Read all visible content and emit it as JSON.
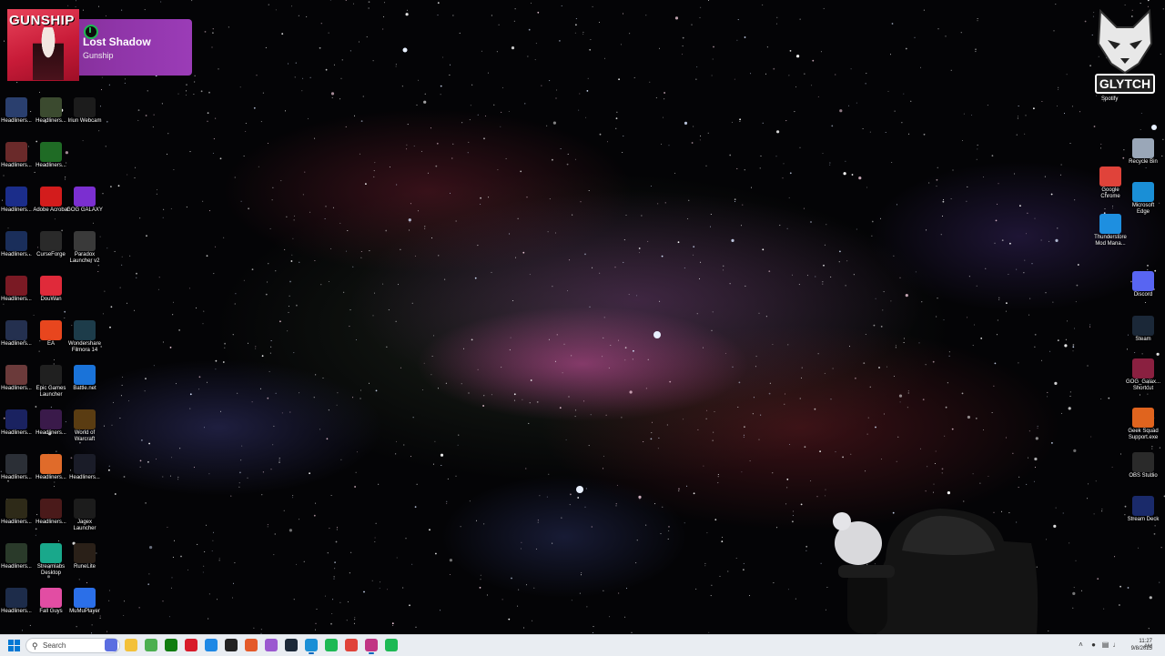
{
  "now_playing": {
    "album_art_text": "GUNSHIP",
    "title": "Lost Shadow",
    "artist": "Gunship"
  },
  "desktop_left": [
    {
      "label": "Headliners...",
      "color": "#2a3f6e",
      "icon": "game-thumb-icon"
    },
    {
      "label": "Headliners...",
      "color": "#3b4a2f",
      "icon": "game-thumb-icon"
    },
    {
      "label": "Iriun Webcam",
      "color": "#1c1c1c",
      "icon": "webcam-icon"
    },
    {
      "label": "Headliners...",
      "color": "#6a2a2a",
      "icon": "game-thumb-icon"
    },
    {
      "label": "Headliners...",
      "color": "#1f6b25",
      "icon": "game-thumb-icon"
    },
    {
      "label": "Headliners...",
      "color": "#1b2d8a",
      "icon": "game-thumb-icon"
    },
    {
      "label": "Adobe Acrobat",
      "color": "#d31c1c",
      "icon": "acrobat-icon"
    },
    {
      "label": "GOG GALAXY",
      "color": "#7b2fd0",
      "icon": "gog-galaxy-icon"
    },
    {
      "label": "Headliners...",
      "color": "#1a2e5a",
      "icon": "game-thumb-icon"
    },
    {
      "label": "CurseForge",
      "color": "#2a2a2a",
      "icon": "curseforge-icon"
    },
    {
      "label": "Paradox Launcher v2",
      "color": "#3a3a3a",
      "icon": "paradox-icon"
    },
    {
      "label": "Headliners...",
      "color": "#7a1a24",
      "icon": "game-thumb-icon"
    },
    {
      "label": "DouWan",
      "color": "#e02a3a",
      "icon": "douwan-icon"
    },
    {
      "label": "Headliners...",
      "color": "#24304f",
      "icon": "game-thumb-icon"
    },
    {
      "label": "EA",
      "color": "#e8461e",
      "icon": "ea-icon"
    },
    {
      "label": "Wondershare Filmora 14",
      "color": "#1d3c4a",
      "icon": "filmora-icon"
    },
    {
      "label": "Headliners...",
      "color": "#6b3a3a",
      "icon": "game-thumb-icon"
    },
    {
      "label": "Epic Games Launcher",
      "color": "#202020",
      "icon": "epic-games-icon"
    },
    {
      "label": "Battle.net",
      "color": "#1a73d9",
      "icon": "battlenet-icon"
    },
    {
      "label": "Headliners...",
      "color": "#1a2260",
      "icon": "game-thumb-icon"
    },
    {
      "label": "Headliners...",
      "color": "#3a1a4a",
      "icon": "game-thumb-icon"
    },
    {
      "label": "World of Warcraft",
      "color": "#5a3c12",
      "icon": "wow-icon"
    },
    {
      "label": "Headliners...",
      "color": "#2b2f36",
      "icon": "game-thumb-icon"
    },
    {
      "label": "Headliners...",
      "color": "#e06b2a",
      "icon": "game-thumb-icon"
    },
    {
      "label": "Headliners...",
      "color": "#1a1c28",
      "icon": "game-thumb-icon"
    },
    {
      "label": "Headliners...",
      "color": "#2e2a18",
      "icon": "game-thumb-icon"
    },
    {
      "label": "Headliners...",
      "color": "#4a1a1a",
      "icon": "game-thumb-icon"
    },
    {
      "label": "Jagex Launcher",
      "color": "#1c1c1c",
      "icon": "jagex-icon"
    },
    {
      "label": "Headliners...",
      "color": "#2a3a2a",
      "icon": "game-thumb-icon"
    },
    {
      "label": "Streamlabs Desktop",
      "color": "#19a88b",
      "icon": "streamlabs-icon"
    },
    {
      "label": "RuneLite",
      "color": "#2a2018",
      "icon": "runelite-icon"
    },
    {
      "label": "Headliners...",
      "color": "#1d2c4a",
      "icon": "game-thumb-icon"
    },
    {
      "label": "Fall Guys",
      "color": "#e24da3",
      "icon": "fall-guys-icon"
    },
    {
      "label": "MuMuPlayer",
      "color": "#2b6fe8",
      "icon": "mumuplayer-icon"
    }
  ],
  "desktop_right": [
    {
      "label": "Recycle Bin",
      "color": "#9aa7b8",
      "icon": "recycle-bin-icon"
    },
    {
      "label": "Google Chrome",
      "color": "#e0433a",
      "icon": "chrome-icon"
    },
    {
      "label": "Microsoft Edge",
      "color": "#1a8fd6",
      "icon": "edge-icon"
    },
    {
      "label": "Thunderstore Mod Mana...",
      "color": "#1e8fe0",
      "icon": "thunderstore-icon"
    },
    {
      "label": "Discord",
      "color": "#5865f2",
      "icon": "discord-icon"
    },
    {
      "label": "Steam",
      "color": "#1b2838",
      "icon": "steam-icon"
    },
    {
      "label": "GOG_Galax... Shortcut",
      "color": "#8a2040",
      "icon": "shortcut-icon"
    },
    {
      "label": "Geek Squad Support.exe",
      "color": "#e0641e",
      "icon": "geek-squad-icon"
    },
    {
      "label": "OBS Studio",
      "color": "#2a2a2a",
      "icon": "obs-icon"
    },
    {
      "label": "Stream Deck",
      "color": "#1a2a6a",
      "icon": "stream-deck-icon"
    }
  ],
  "overlay": {
    "logo_text": "GLYTCH",
    "logo_sub": "Spotify"
  },
  "taskbar": {
    "search_placeholder": "Search",
    "apps": [
      {
        "name": "copilot-app",
        "color": "#5b6ee1"
      },
      {
        "name": "file-explorer",
        "color": "#f3c13a"
      },
      {
        "name": "minecraft",
        "color": "#4caf50"
      },
      {
        "name": "xbox",
        "color": "#107c10"
      },
      {
        "name": "adobe-app",
        "color": "#d81b2a"
      },
      {
        "name": "store",
        "color": "#1e88e5"
      },
      {
        "name": "obs",
        "color": "#222222"
      },
      {
        "name": "curseforge",
        "color": "#e45a2a"
      },
      {
        "name": "gog",
        "color": "#9b59d0"
      },
      {
        "name": "steam",
        "color": "#1b2838"
      },
      {
        "name": "edge",
        "color": "#1a8fd6"
      },
      {
        "name": "spotify",
        "color": "#1db954"
      },
      {
        "name": "chrome",
        "color": "#e0433a"
      },
      {
        "name": "photos",
        "color": "#c13584"
      },
      {
        "name": "spotify-2",
        "color": "#1db954"
      }
    ],
    "clock_time": "11:27 AM",
    "clock_date": "9/8/2025"
  }
}
